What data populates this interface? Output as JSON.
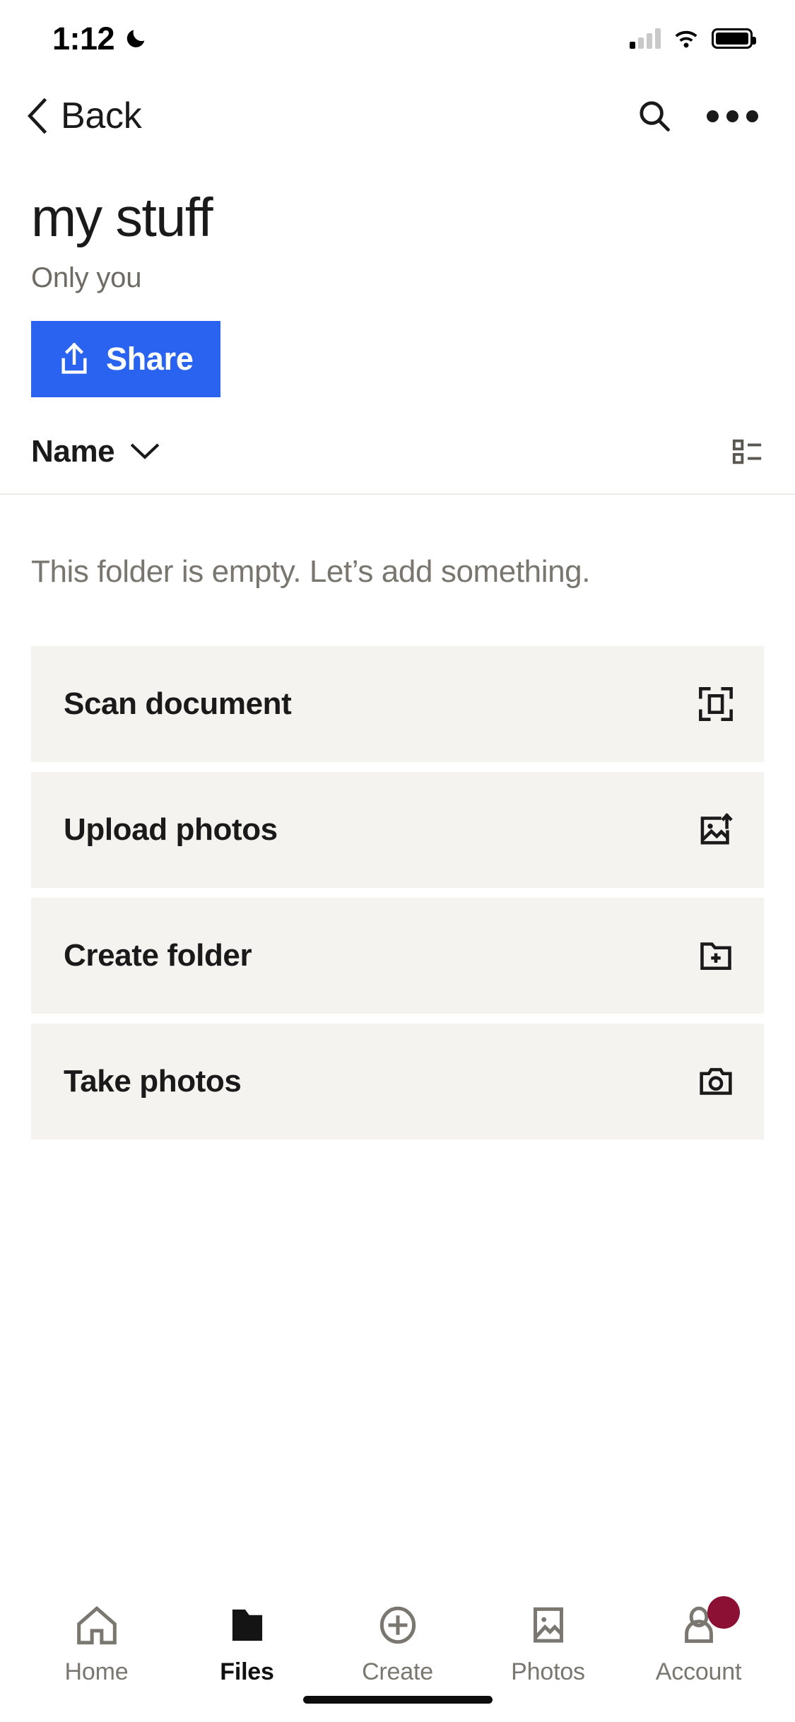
{
  "status_bar": {
    "time": "1:12",
    "dnd_icon": "moon-icon",
    "signal_icon": "cellular-signal-icon",
    "wifi_icon": "wifi-icon",
    "battery_icon": "battery-icon"
  },
  "nav": {
    "back_label": "Back",
    "back_icon": "chevron-left-icon",
    "search_icon": "search-icon",
    "more_icon": "more-horizontal-icon"
  },
  "header": {
    "title": "my stuff",
    "subtitle": "Only you",
    "share_label": "Share",
    "share_icon": "share-upload-icon",
    "accent_color": "#2a63ef"
  },
  "sortbar": {
    "sort_label": "Name",
    "sort_chevron_icon": "chevron-down-icon",
    "view_toggle_icon": "list-view-icon"
  },
  "main": {
    "empty_message": "This folder is empty. Let’s add something.",
    "actions": [
      {
        "label": "Scan document",
        "icon": "scan-document-icon"
      },
      {
        "label": "Upload photos",
        "icon": "image-upload-icon"
      },
      {
        "label": "Create folder",
        "icon": "folder-plus-icon"
      },
      {
        "label": "Take photos",
        "icon": "camera-icon"
      }
    ]
  },
  "tabbar": {
    "tabs": [
      {
        "label": "Home",
        "icon": "home-icon",
        "active": false,
        "badge": false
      },
      {
        "label": "Files",
        "icon": "folder-filled-icon",
        "active": true,
        "badge": false
      },
      {
        "label": "Create",
        "icon": "plus-circle-icon",
        "active": false,
        "badge": false
      },
      {
        "label": "Photos",
        "icon": "photos-icon",
        "active": false,
        "badge": false
      },
      {
        "label": "Account",
        "icon": "account-person-icon",
        "active": false,
        "badge": true
      }
    ],
    "badge_color": "#8c1034"
  }
}
